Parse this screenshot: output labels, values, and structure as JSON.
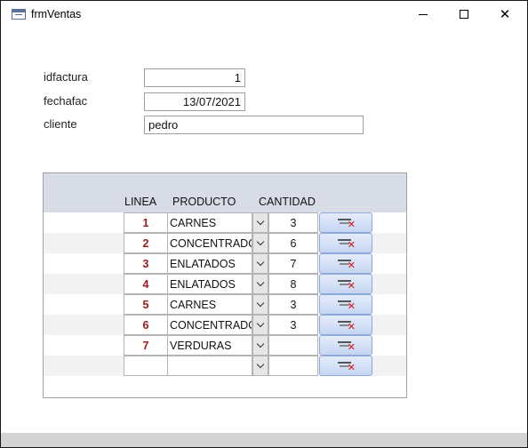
{
  "window": {
    "title": "frmVentas",
    "app_icon": "form-icon",
    "controls": {
      "minimize": "minimize-icon",
      "maximize": "maximize-icon",
      "close": "✕"
    }
  },
  "form": {
    "idfactura": {
      "label": "idfactura",
      "value": "1"
    },
    "fechafac": {
      "label": "fechafac",
      "value": "13/07/2021"
    },
    "cliente": {
      "label": "cliente",
      "value": "pedro"
    }
  },
  "subform": {
    "headers": {
      "linea": "LINEA",
      "producto": "PRODUCTO",
      "cantidad": "CANTIDAD"
    },
    "rows": [
      {
        "linea": "1",
        "producto": "CARNES",
        "cantidad": "3"
      },
      {
        "linea": "2",
        "producto": "CONCENTRADOS",
        "cantidad": "6"
      },
      {
        "linea": "3",
        "producto": "ENLATADOS",
        "cantidad": "7"
      },
      {
        "linea": "4",
        "producto": "ENLATADOS",
        "cantidad": "8"
      },
      {
        "linea": "5",
        "producto": "CARNES",
        "cantidad": "3"
      },
      {
        "linea": "6",
        "producto": "CONCENTRADOS",
        "cantidad": "3"
      },
      {
        "linea": "7",
        "producto": "VERDURAS",
        "cantidad": ""
      },
      {
        "linea": "",
        "producto": "",
        "cantidad": ""
      }
    ],
    "delete_icon": "delete-record-icon"
  },
  "colors": {
    "header_band": "#d7dce6",
    "line_number": "#a01818",
    "alt_row": "#f2f2f2",
    "delete_button": "#c5d6f2",
    "status_bar": "#d4d4d4"
  }
}
